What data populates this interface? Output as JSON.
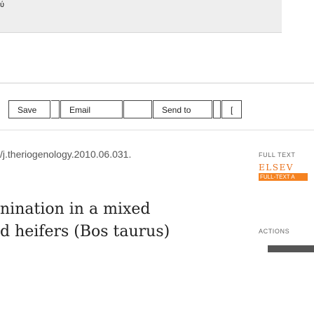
{
  "header": {
    "logo_glyph": "ύ"
  },
  "toolbar": {
    "save_label": "Save",
    "email_label": "Email",
    "send_to_label": "Send to",
    "more_label": "["
  },
  "article": {
    "doi_fragment": "/j.theriogenology.2010.06.031.",
    "title_line_1": "nination in a mixed",
    "title_line_2": "d heifers (Bos taurus)"
  },
  "sidebar": {
    "full_text_label": "FULL TEXT",
    "provider_name": "ELSEV",
    "provider_sub": "FULL-TEXT A",
    "actions_label": "ACTIONS"
  },
  "colors": {
    "elsevier_orange": "#f58220",
    "toolbar_border": "#444444",
    "gray_header": "#eeeeee"
  }
}
